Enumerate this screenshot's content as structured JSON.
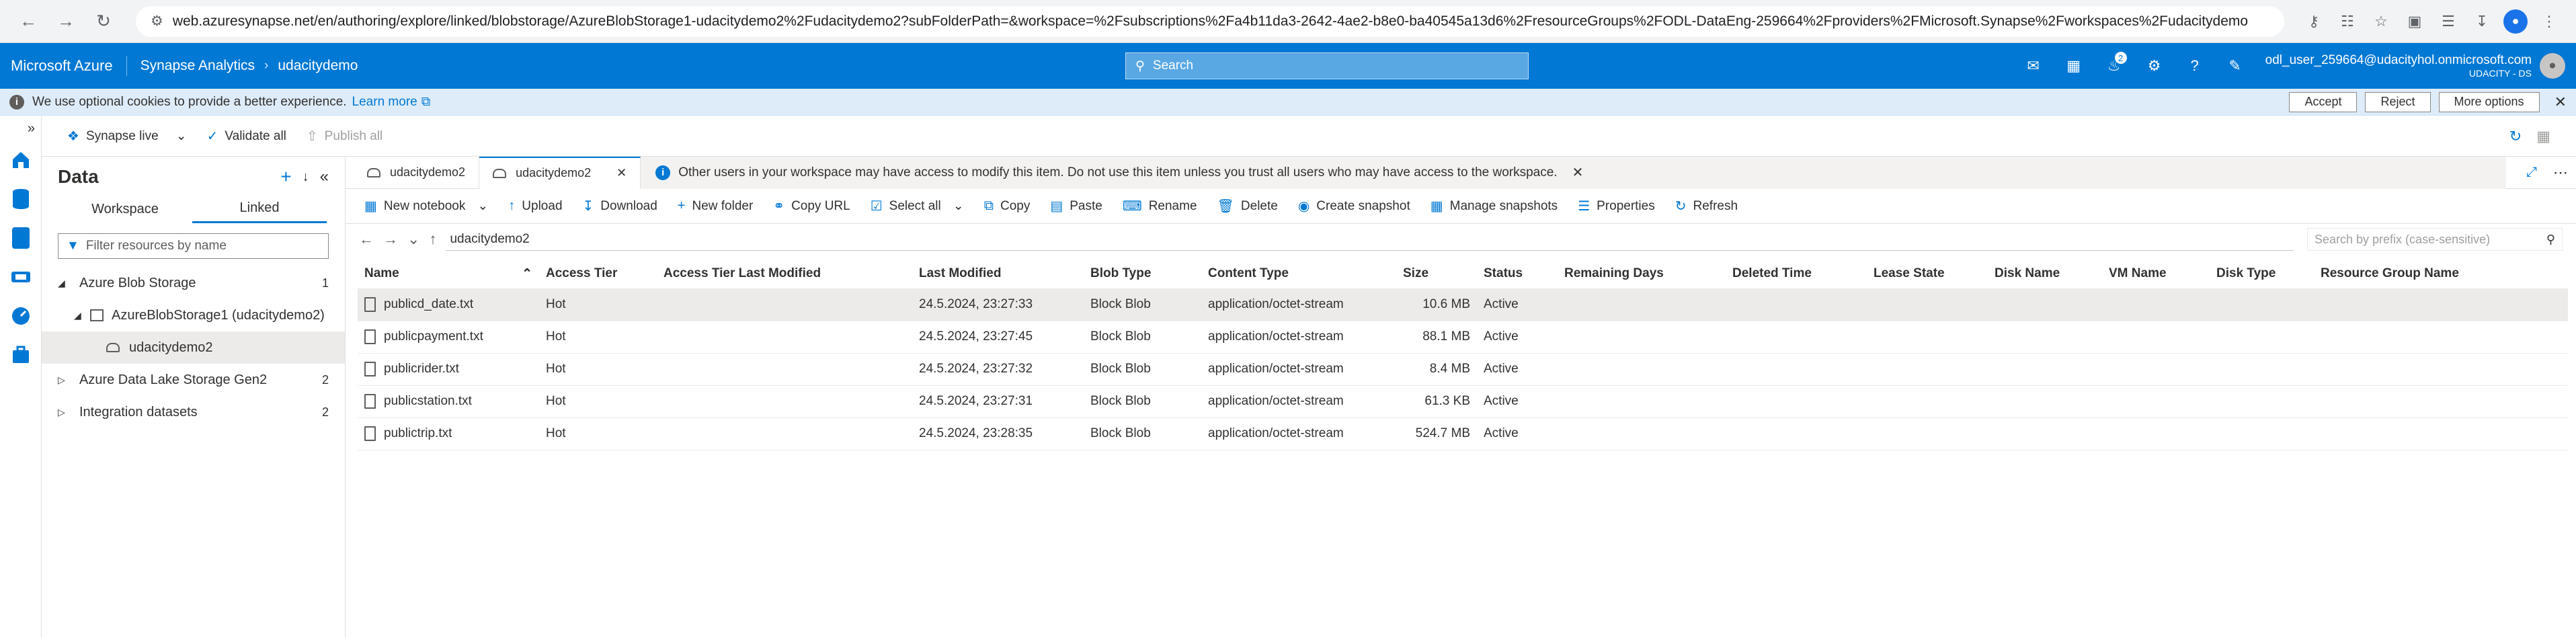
{
  "browser": {
    "url": "web.azuresynapse.net/en/authoring/explore/linked/blobstorage/AzureBlobStorage1-udacitydemo2%2Fudacitydemo2?subFolderPath=&workspace=%2Fsubscriptions%2Fa4b11da3-2642-4ae2-b8e0-ba40545a13d6%2FresourceGroups%2FODL-DataEng-259664%2Fproviders%2FMicrosoft.Synapse%2Fworkspaces%2Fudacitydemo"
  },
  "topbar": {
    "brand": "Microsoft Azure",
    "service": "Synapse Analytics",
    "workspace": "udacitydemo",
    "search_placeholder": "Search",
    "notifications_count": "2",
    "user_email": "odl_user_259664@udacityhol.onmicrosoft.com",
    "user_tenant": "UDACITY - DS"
  },
  "cookie_bar": {
    "message": "We use optional cookies to provide a better experience.",
    "learn_more": "Learn more",
    "accept": "Accept",
    "reject": "Reject",
    "more_options": "More options"
  },
  "top_commands": {
    "synapse_live": "Synapse live",
    "validate_all": "Validate all",
    "publish_all": "Publish all"
  },
  "data_pane": {
    "title": "Data",
    "pivot_workspace": "Workspace",
    "pivot_linked": "Linked",
    "filter_placeholder": "Filter resources by name",
    "tree": [
      {
        "label": "Azure Blob Storage",
        "count": "1"
      },
      {
        "label": "AzureBlobStorage1 (udacitydemo2)"
      },
      {
        "label": "udacitydemo2"
      },
      {
        "label": "Azure Data Lake Storage Gen2",
        "count": "2"
      },
      {
        "label": "Integration datasets",
        "count": "2"
      }
    ]
  },
  "tabs": [
    {
      "label": "udacitydemo2"
    },
    {
      "label": "udacitydemo2"
    }
  ],
  "info_message": "Other users in your workspace may have access to modify this item. Do not use this item unless you trust all users who may have access to the workspace.",
  "commands": {
    "new_notebook": "New notebook",
    "upload": "Upload",
    "download": "Download",
    "new_folder": "New folder",
    "copy_url": "Copy URL",
    "select_all": "Select all",
    "copy": "Copy",
    "paste": "Paste",
    "rename": "Rename",
    "delete": "Delete",
    "create_snapshot": "Create snapshot",
    "manage_snapshots": "Manage snapshots",
    "properties": "Properties",
    "refresh": "Refresh"
  },
  "path": {
    "current": "udacitydemo2",
    "search_placeholder": "Search by prefix (case-sensitive)"
  },
  "table": {
    "headers": [
      "Name",
      "Access Tier",
      "Access Tier Last Modified",
      "Last Modified",
      "Blob Type",
      "Content Type",
      "Size",
      "Status",
      "Remaining Days",
      "Deleted Time",
      "Lease State",
      "Disk Name",
      "VM Name",
      "Disk Type",
      "Resource Group Name"
    ],
    "rows": [
      {
        "name": "publicd_date.txt",
        "tier": "Hot",
        "modified": "24.5.2024, 23:27:33",
        "blob": "Block Blob",
        "ctype": "application/octet-stream",
        "size": "10.6 MB",
        "status": "Active"
      },
      {
        "name": "publicpayment.txt",
        "tier": "Hot",
        "modified": "24.5.2024, 23:27:45",
        "blob": "Block Blob",
        "ctype": "application/octet-stream",
        "size": "88.1 MB",
        "status": "Active"
      },
      {
        "name": "publicrider.txt",
        "tier": "Hot",
        "modified": "24.5.2024, 23:27:32",
        "blob": "Block Blob",
        "ctype": "application/octet-stream",
        "size": "8.4 MB",
        "status": "Active"
      },
      {
        "name": "publicstation.txt",
        "tier": "Hot",
        "modified": "24.5.2024, 23:27:31",
        "blob": "Block Blob",
        "ctype": "application/octet-stream",
        "size": "61.3 KB",
        "status": "Active"
      },
      {
        "name": "publictrip.txt",
        "tier": "Hot",
        "modified": "24.5.2024, 23:28:35",
        "blob": "Block Blob",
        "ctype": "application/octet-stream",
        "size": "524.7 MB",
        "status": "Active"
      }
    ]
  }
}
